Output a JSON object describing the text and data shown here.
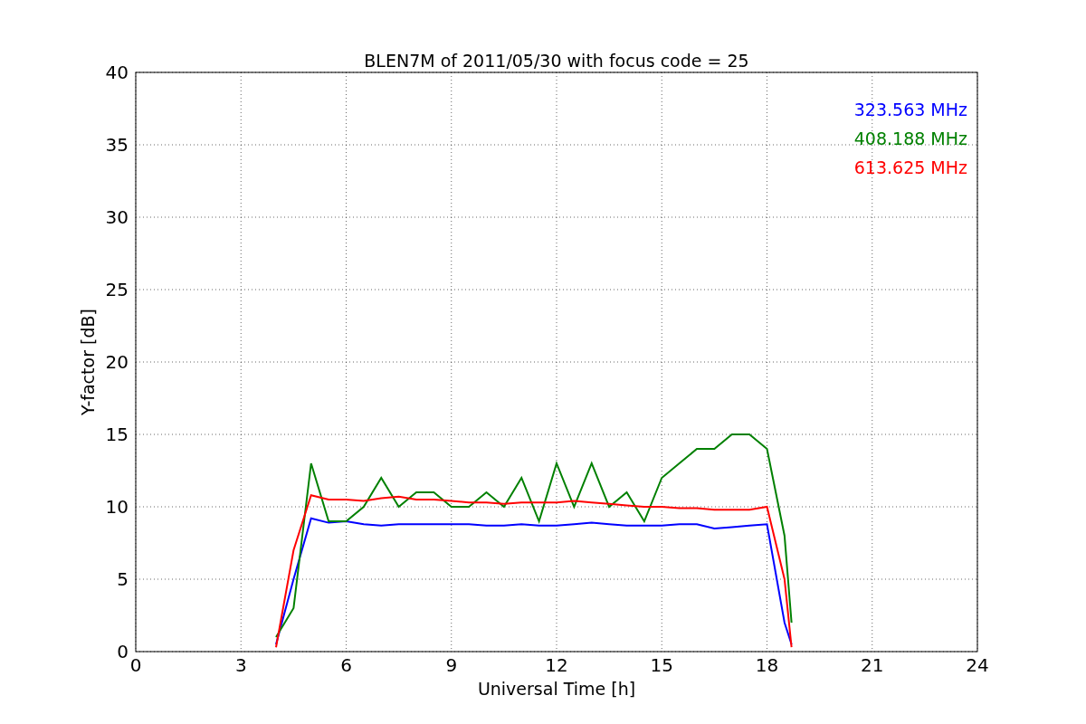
{
  "chart_data": {
    "type": "line",
    "title": "BLEN7M of 2011/05/30 with focus code = 25",
    "xlabel": "Universal Time [h]",
    "ylabel": "Y-factor [dB]",
    "x": [
      4,
      4.5,
      5,
      5.5,
      6,
      6.5,
      7,
      7.5,
      8,
      8.5,
      9,
      9.5,
      10,
      10.5,
      11,
      11.5,
      12,
      12.5,
      13,
      13.5,
      14,
      14.5,
      15,
      15.5,
      16,
      16.5,
      17,
      17.5,
      18,
      18.5,
      18.7
    ],
    "series": [
      {
        "name": "323.563 MHz",
        "color": "#0000ff",
        "values": [
          0.5,
          5,
          9.2,
          8.9,
          9,
          8.8,
          8.7,
          8.8,
          8.8,
          8.8,
          8.8,
          8.8,
          8.7,
          8.7,
          8.8,
          8.7,
          8.7,
          8.8,
          8.9,
          8.8,
          8.7,
          8.7,
          8.7,
          8.8,
          8.8,
          8.5,
          8.6,
          8.7,
          8.8,
          2,
          0.5
        ]
      },
      {
        "name": "408.188 MHz",
        "color": "#008000",
        "values": [
          1,
          3,
          13,
          9,
          9,
          10,
          12,
          10,
          11,
          11,
          10,
          10,
          11,
          10,
          12,
          9,
          13,
          10,
          13,
          10,
          11,
          9,
          12,
          13,
          14,
          14,
          15,
          15,
          14,
          8,
          2
        ]
      },
      {
        "name": "613.625 MHz",
        "color": "#ff0000",
        "values": [
          0.3,
          7,
          10.8,
          10.5,
          10.5,
          10.4,
          10.6,
          10.7,
          10.5,
          10.5,
          10.4,
          10.3,
          10.3,
          10.2,
          10.3,
          10.3,
          10.3,
          10.4,
          10.3,
          10.2,
          10.1,
          10,
          10,
          9.9,
          9.9,
          9.8,
          9.8,
          9.8,
          10,
          5,
          0.3
        ]
      }
    ],
    "xlim": [
      0,
      24
    ],
    "ylim": [
      0,
      40
    ],
    "xticks": [
      0,
      3,
      6,
      9,
      12,
      15,
      18,
      21,
      24
    ],
    "yticks": [
      0,
      5,
      10,
      15,
      20,
      25,
      30,
      35,
      40
    ],
    "grid": true
  }
}
